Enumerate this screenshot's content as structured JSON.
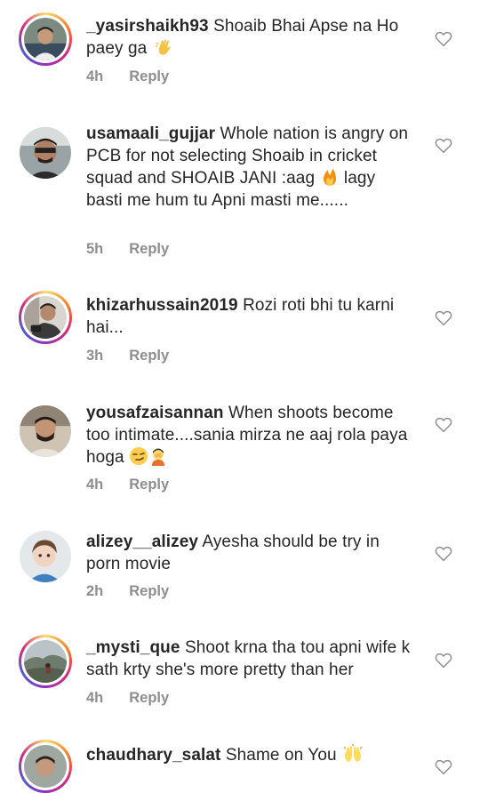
{
  "comments": [
    {
      "username": "_yasirshaikh93",
      "text": "Shoaib Bhai Apse na Ho paey ga",
      "emoji": "waving-hand",
      "time": "4h",
      "reply": "Reply"
    },
    {
      "username": "usamaali_gujjar",
      "text": "Whole nation is angry on PCB for not selecting Shoaib in cricket squad and SHOAIB JANI :aag",
      "text2": "lagy basti me hum tu Apni masti me......",
      "emoji": "fire",
      "time": "5h",
      "reply": "Reply"
    },
    {
      "username": "khizarhussain2019",
      "text": "Rozi roti bhi tu karni hai...",
      "time": "3h",
      "reply": "Reply"
    },
    {
      "username": "yousafzaisannan",
      "text": "When shoots become too intimate....sania mirza ne aaj rola paya hoga",
      "emoji": "smirk-facepalm",
      "time": "4h",
      "reply": "Reply"
    },
    {
      "username": "alizey__alizey",
      "text": "Ayesha should be try in porn movie",
      "time": "2h",
      "reply": "Reply"
    },
    {
      "username": "_mysti_que",
      "text": "Shoot krna tha tou apni wife k sath krty she's more pretty than her",
      "time": "4h",
      "reply": "Reply"
    },
    {
      "username": "chaudhary_salat",
      "text": "Shame on You",
      "emoji": "raising-hands",
      "time": "",
      "reply": ""
    }
  ],
  "icons": {
    "like": "heart-outline-icon"
  },
  "colors": {
    "username": "#262626",
    "meta": "#8e8e8e",
    "heart": "#8e8e8e"
  }
}
